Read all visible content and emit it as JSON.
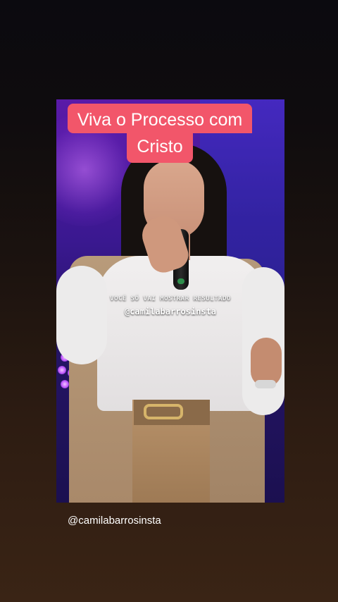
{
  "story": {
    "title_line_1": "Viva o Processo com",
    "title_line_2": "Cristo",
    "video_caption": "VOCÊ SÓ VAI MOSTRAR RESULTADO",
    "video_watermark": "@camilabarrosinsta",
    "mention": "@camilabarrosinsta"
  },
  "colors": {
    "sticker_background": "#f2566a",
    "sticker_text": "#ffffff"
  }
}
